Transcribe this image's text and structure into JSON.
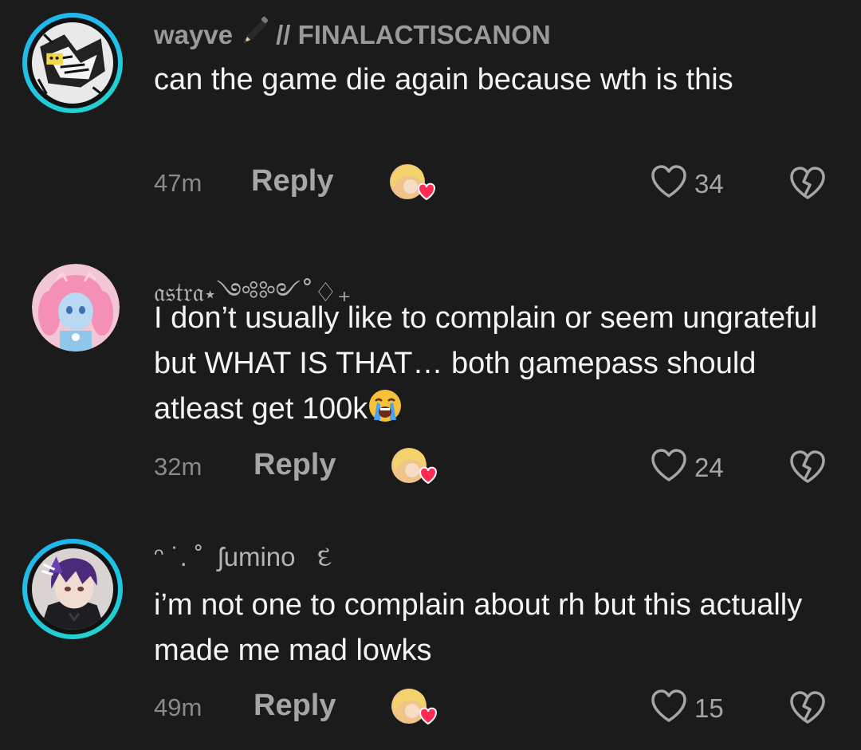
{
  "comments": [
    {
      "username": "wayve",
      "username_suffix": "// FINALACTISCANON",
      "text": "can the game die again because wth is this",
      "time": "47m",
      "reply_label": "Reply",
      "likes": "34"
    },
    {
      "username": "𝔞𝔰𝔱𝔯𝔞⋆༺༻˚♢₊",
      "text": "I don’t usually like to complain or seem ungrateful but WHAT IS THAT… both gamepass should atleast get 100k",
      "time": "32m",
      "reply_label": "Reply",
      "likes": "24"
    },
    {
      "username": "ᵔ ˙. ˚  ʃumino   દ",
      "text": "i’m not one to complain about rh but this actually made me mad lowks",
      "time": "49m",
      "reply_label": "Reply",
      "likes": "15"
    }
  ],
  "colors": {
    "background": "#1b1b1b",
    "story_ring_start": "#1fb3ef",
    "story_ring_end": "#24d6c6",
    "muted_text": "#8a8a8a",
    "body_text": "#f4f4f4"
  },
  "icons": {
    "heart": "heart-outline-icon",
    "dislike": "broken-heart-icon",
    "creator_liked": "creator-liked-badge-icon",
    "pencil": "pencil-emoji-icon",
    "crying": "loudly-crying-face-emoji-icon"
  }
}
